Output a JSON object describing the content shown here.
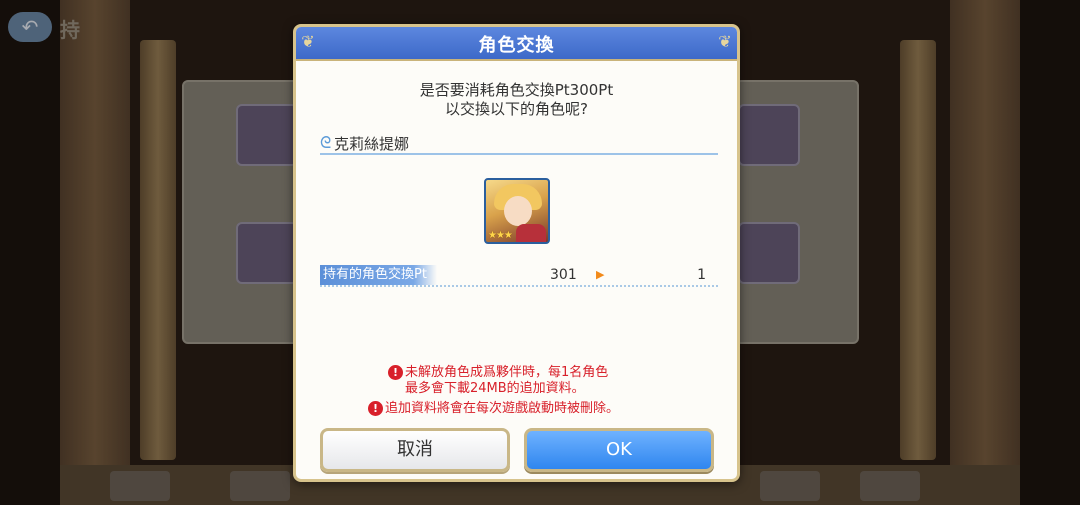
{
  "background": {
    "back_label": "↶",
    "title": "持"
  },
  "dialog": {
    "title": "角色交換",
    "question_line1": "是否要消耗角色交換Pt300Pt",
    "question_line2": "以交換以下的角色呢?",
    "character_name": "克莉絲提娜",
    "character_stars": "★★★",
    "points_label": "持有的角色交換Pt",
    "points_before": "301",
    "points_after": "1",
    "warning1_line1": "未解放角色成爲夥伴時，每1名角色",
    "warning1_line2": "最多會下載24MB的追加資料。",
    "warning2": "追加資料將會在每次遊戲啟動時被刪除。",
    "cancel_label": "取消",
    "ok_label": "OK"
  },
  "colors": {
    "header": "#4a78d4",
    "ok_button": "#2f86ef",
    "warning": "#d8202a",
    "arrow": "#f28a1a"
  }
}
